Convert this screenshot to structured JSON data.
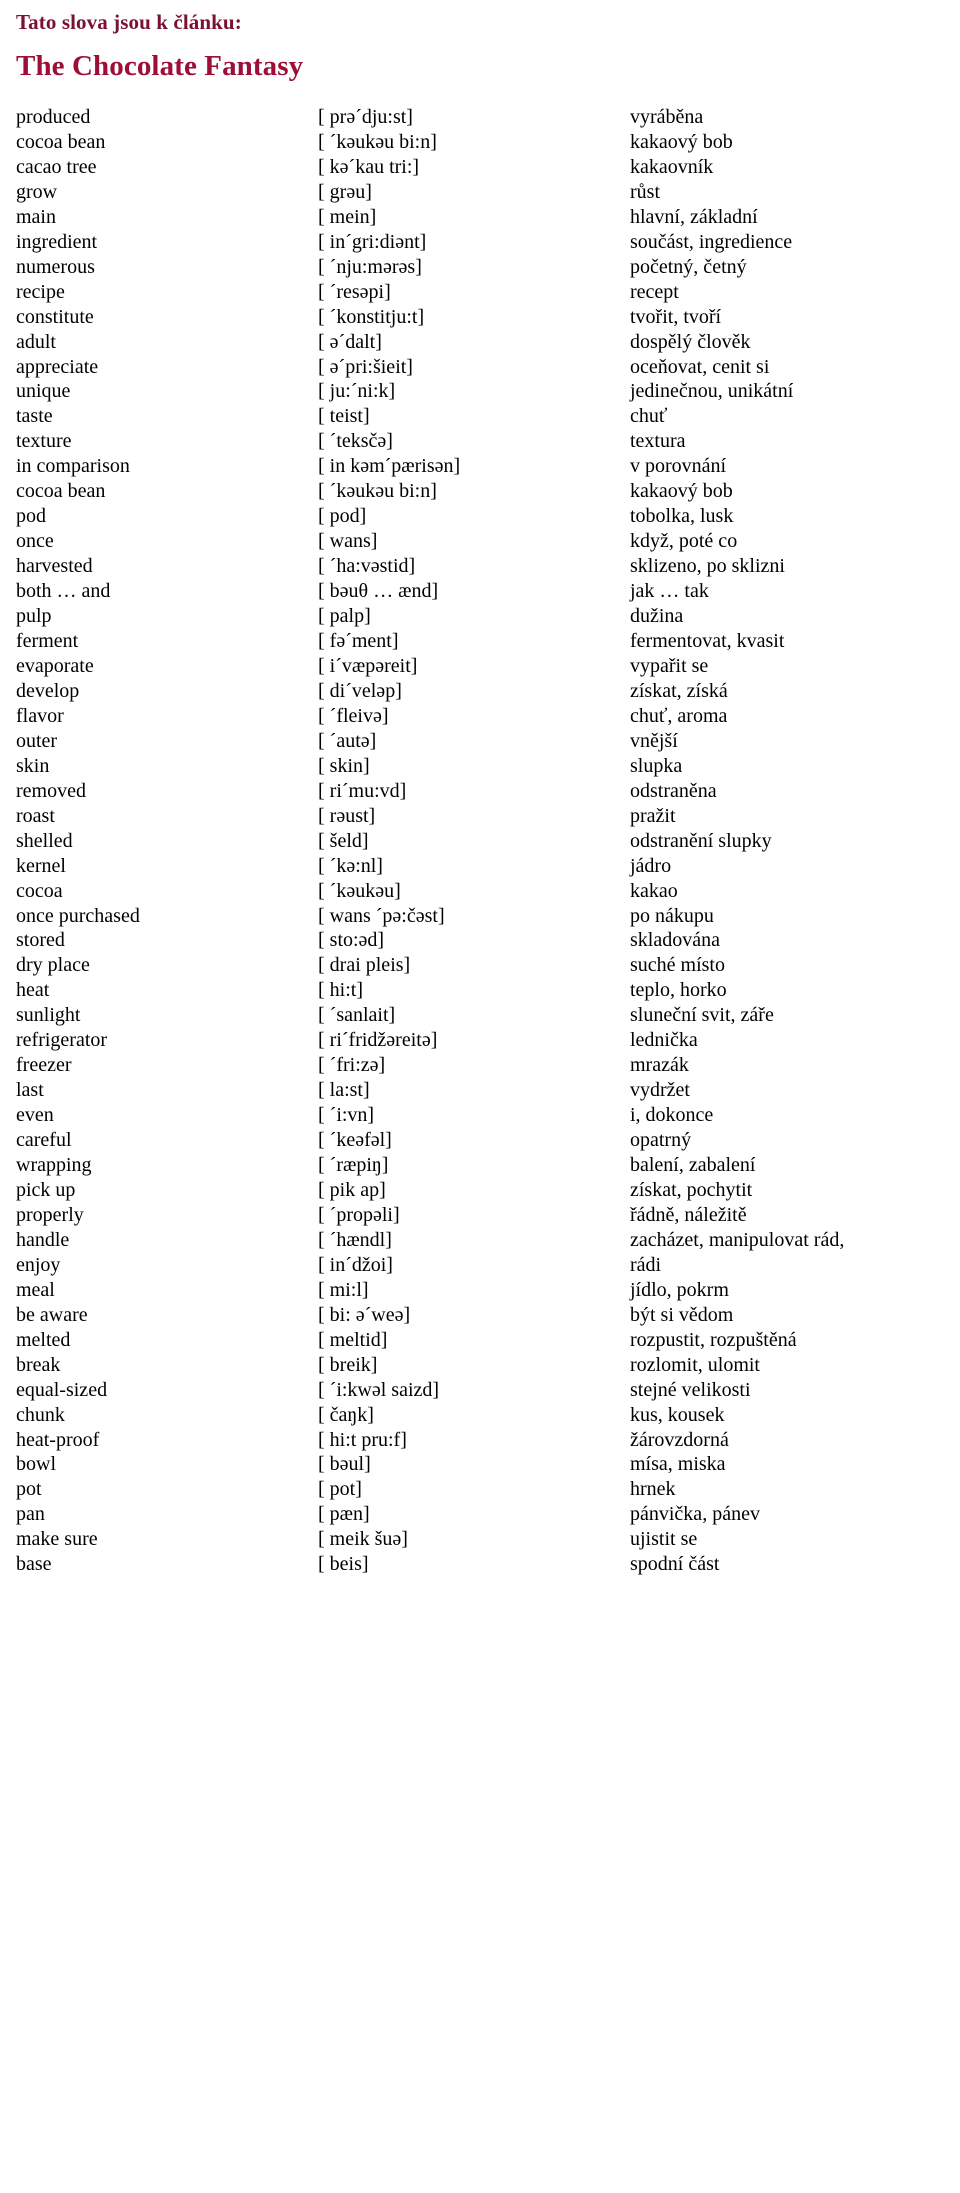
{
  "document": {
    "kicker": "Tato slova jsou k článku:",
    "title": "The Chocolate Fantasy",
    "kicker_color": "#7b1030",
    "title_color": "#9e0f36"
  },
  "columns": [
    "english",
    "transcription",
    "czech"
  ],
  "rows": [
    {
      "english": "produced",
      "ipa": "[ prə´dju:st]",
      "czech": "vyráběna"
    },
    {
      "english": "cocoa bean",
      "ipa": "[ ´kəukəu bi:n]",
      "czech": "kakaový bob"
    },
    {
      "english": "cacao tree",
      "ipa": "[ kə´kau tri:]",
      "czech": "kakaovník"
    },
    {
      "english": "grow",
      "ipa": "[ grəu]",
      "czech": "růst"
    },
    {
      "english": "main",
      "ipa": "[ mein]",
      "czech": "hlavní, základní"
    },
    {
      "english": "ingredient",
      "ipa": "[ in´gri:diənt]",
      "czech": "součást, ingredience"
    },
    {
      "english": "numerous",
      "ipa": "[ ´nju:mərəs]",
      "czech": "početný, četný"
    },
    {
      "english": "recipe",
      "ipa": "[ ´resəpi]",
      "czech": "recept"
    },
    {
      "english": "constitute",
      "ipa": "[ ´konstitju:t]",
      "czech": "tvořit, tvoří"
    },
    {
      "english": "adult",
      "ipa": "[ ə´dalt]",
      "czech": "dospělý člověk"
    },
    {
      "english": "appreciate",
      "ipa": "[ ə´pri:šieit]",
      "czech": "oceňovat, cenit si"
    },
    {
      "english": "unique",
      "ipa": "[ ju:´ni:k]",
      "czech": "jedinečnou, unikátní"
    },
    {
      "english": "taste",
      "ipa": "[ teist]",
      "czech": "chuť"
    },
    {
      "english": "texture",
      "ipa": "[ ´teksčə]",
      "czech": "textura"
    },
    {
      "english": "in comparison",
      "ipa": "[ in kəm´pærisən]",
      "czech": "v porovnání"
    },
    {
      "english": "cocoa bean",
      "ipa": "[ ´kəukəu bi:n]",
      "czech": "kakaový bob"
    },
    {
      "english": "pod",
      "ipa": "[ pod]",
      "czech": "tobolka, lusk"
    },
    {
      "english": "once",
      "ipa": "[ wans]",
      "czech": "když, poté co"
    },
    {
      "english": "harvested",
      "ipa": "[ ´ha:vəstid]",
      "czech": "sklizeno, po sklizni"
    },
    {
      "english": "both … and",
      "ipa": "[ bəuθ … ænd]",
      "czech": "jak … tak"
    },
    {
      "english": "pulp",
      "ipa": "[ palp]",
      "czech": "dužina"
    },
    {
      "english": "ferment",
      "ipa": "[ fə´ment]",
      "czech": "fermentovat, kvasit"
    },
    {
      "english": "evaporate",
      "ipa": "[ i´væpəreit]",
      "czech": "vypařit se"
    },
    {
      "english": "develop",
      "ipa": "[ di´veləp]",
      "czech": "získat, získá"
    },
    {
      "english": "flavor",
      "ipa": "[ ´fleivə]",
      "czech": "chuť, aroma"
    },
    {
      "english": "outer",
      "ipa": "[ ´autə]",
      "czech": "vnější"
    },
    {
      "english": "skin",
      "ipa": "[ skin]",
      "czech": "slupka"
    },
    {
      "english": "removed",
      "ipa": "[ ri´mu:vd]",
      "czech": "odstraněna"
    },
    {
      "english": "roast",
      "ipa": "[ rəust]",
      "czech": "pražit"
    },
    {
      "english": "shelled",
      "ipa": "[ šeld]",
      "czech": "odstranění slupky"
    },
    {
      "english": "kernel",
      "ipa": "[ ´kə:nl]",
      "czech": "jádro"
    },
    {
      "english": "cocoa",
      "ipa": "[ ´kəukəu]",
      "czech": "kakao"
    },
    {
      "english": "once purchased",
      "ipa": "[ wans ´pə:čəst]",
      "czech": "po nákupu"
    },
    {
      "english": "stored",
      "ipa": "[ sto:əd]",
      "czech": "skladována"
    },
    {
      "english": "dry place",
      "ipa": "[ drai pleis]",
      "czech": "suché místo"
    },
    {
      "english": "heat",
      "ipa": "[ hi:t]",
      "czech": "teplo, horko"
    },
    {
      "english": "sunlight",
      "ipa": "[ ´sanlait]",
      "czech": "sluneční svit, záře"
    },
    {
      "english": "refrigerator",
      "ipa": "[ ri´fridžəreitə]",
      "czech": "lednička"
    },
    {
      "english": "freezer",
      "ipa": "[ ´fri:zə]",
      "czech": "mrazák"
    },
    {
      "english": "last",
      "ipa": "[ la:st]",
      "czech": "vydržet"
    },
    {
      "english": "even",
      "ipa": "[ ´i:vn]",
      "czech": "i, dokonce"
    },
    {
      "english": "careful",
      "ipa": "[ ´keəfəl]",
      "czech": "opatrný"
    },
    {
      "english": "wrapping",
      "ipa": "[ ´ræpiŋ]",
      "czech": "balení, zabalení"
    },
    {
      "english": "pick up",
      "ipa": "[ pik ap]",
      "czech": "získat, pochytit"
    },
    {
      "english": "properly",
      "ipa": "[ ´propəli]",
      "czech": "řádně, náležitě"
    },
    {
      "english": "handle",
      "ipa": "[ ´hændl]",
      "czech": "zacházet, manipulovat rád,"
    },
    {
      "english": "enjoy",
      "ipa": "[ in´džoi]",
      "czech": "rádi"
    },
    {
      "english": "meal",
      "ipa": "[ mi:l]",
      "czech": "jídlo, pokrm"
    },
    {
      "english": "be aware",
      "ipa": "[ bi: ə´weə]",
      "czech": "být si vědom"
    },
    {
      "english": "melted",
      "ipa": "[ meltid]",
      "czech": "rozpustit, rozpuštěná"
    },
    {
      "english": "break",
      "ipa": "[ breik]",
      "czech": "rozlomit, ulomit"
    },
    {
      "english": "equal-sized",
      "ipa": "[ ´i:kwəl saizd]",
      "czech": "stejné velikosti"
    },
    {
      "english": "chunk",
      "ipa": "[ čaŋk]",
      "czech": "kus, kousek"
    },
    {
      "english": "heat-proof",
      "ipa": "[ hi:t pru:f]",
      "czech": "žárovzdorná"
    },
    {
      "english": "bowl",
      "ipa": "[ bəul]",
      "czech": "mísa, miska"
    },
    {
      "english": "pot",
      "ipa": "[ pot]",
      "czech": "hrnek"
    },
    {
      "english": "pan",
      "ipa": "[ pæn]",
      "czech": "pánvička, pánev"
    },
    {
      "english": "make sure",
      "ipa": "[ meik šuə]",
      "czech": "ujistit se"
    },
    {
      "english": "base",
      "ipa": "[ beis]",
      "czech": "spodní část"
    }
  ]
}
